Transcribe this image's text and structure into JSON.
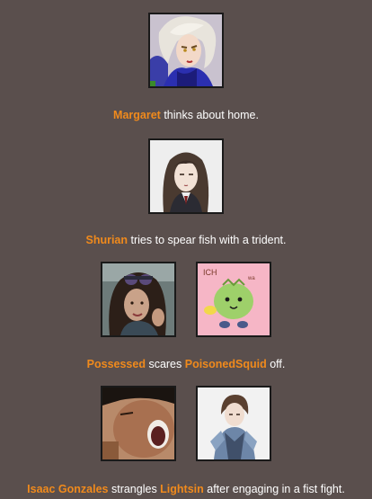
{
  "events": [
    {
      "tributes": [
        {
          "name": "Margaret",
          "portrait": "blonde-woman-blue-dress-portrait"
        }
      ],
      "text": {
        "name1": "Margaret",
        "action": " thinks about home."
      }
    },
    {
      "tributes": [
        {
          "name": "Shurian",
          "portrait": "dark-haired-girl-uniform-portrait"
        }
      ],
      "text": {
        "name1": "Shurian",
        "action": " tries to spear fish with a trident."
      }
    },
    {
      "tributes": [
        {
          "name": "Possessed",
          "portrait": "curly-haired-woman-goggles-photo"
        },
        {
          "name": "PoisonedSquid",
          "portrait": "green-blob-character-pink-background"
        }
      ],
      "text": {
        "name1": "Possessed",
        "middle": " scares ",
        "name2": "PoisonedSquid",
        "end": " off."
      }
    },
    {
      "tributes": [
        {
          "name": "Isaac Gonzales",
          "portrait": "screaming-boy-closeup-photo"
        },
        {
          "name": "Lightsin",
          "portrait": "dark-haired-boy-armor-portrait"
        }
      ],
      "text": {
        "name1": "Isaac Gonzales",
        "middle": " strangles ",
        "name2": "Lightsin",
        "end": " after engaging in a fist fight."
      }
    }
  ],
  "colors": {
    "background": "#5a4f4d",
    "tribute_name": "#f08a1c",
    "text": "#ffffff"
  }
}
